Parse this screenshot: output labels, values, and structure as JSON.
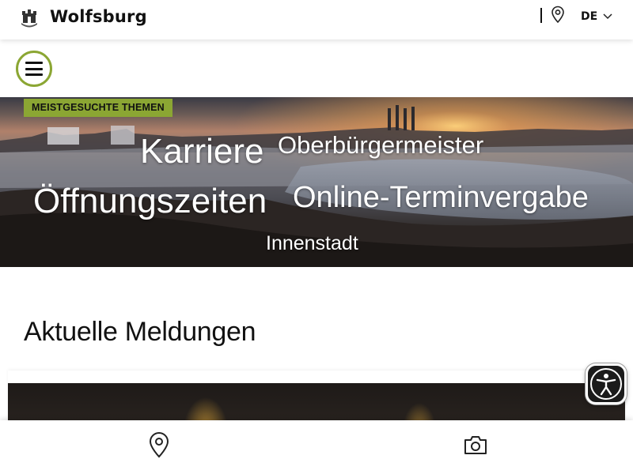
{
  "header": {
    "brand": "Wolfsburg",
    "logo_icon": "city-crest-icon",
    "location_icon": "map-pin-icon",
    "language": "DE",
    "language_chevron_icon": "chevron-down-icon"
  },
  "menu": {
    "icon": "hamburger-menu-icon",
    "accent_color": "#8ba633"
  },
  "hero": {
    "badge": "MEISTGESUCHTE THEMEN",
    "topics": [
      "Karriere",
      "Oberbürgermeister",
      "Öffnungszeiten",
      "Online-Terminvergabe",
      "Innenstadt"
    ]
  },
  "news": {
    "title": "Aktuelle Meldungen"
  },
  "accessibility": {
    "icon": "accessibility-person-icon"
  },
  "bottom_nav": {
    "items": [
      {
        "icon": "map-pin-icon"
      },
      {
        "icon": "camera-icon"
      }
    ]
  },
  "colors": {
    "accent": "#8ba633",
    "text": "#111111",
    "background": "#ffffff"
  }
}
